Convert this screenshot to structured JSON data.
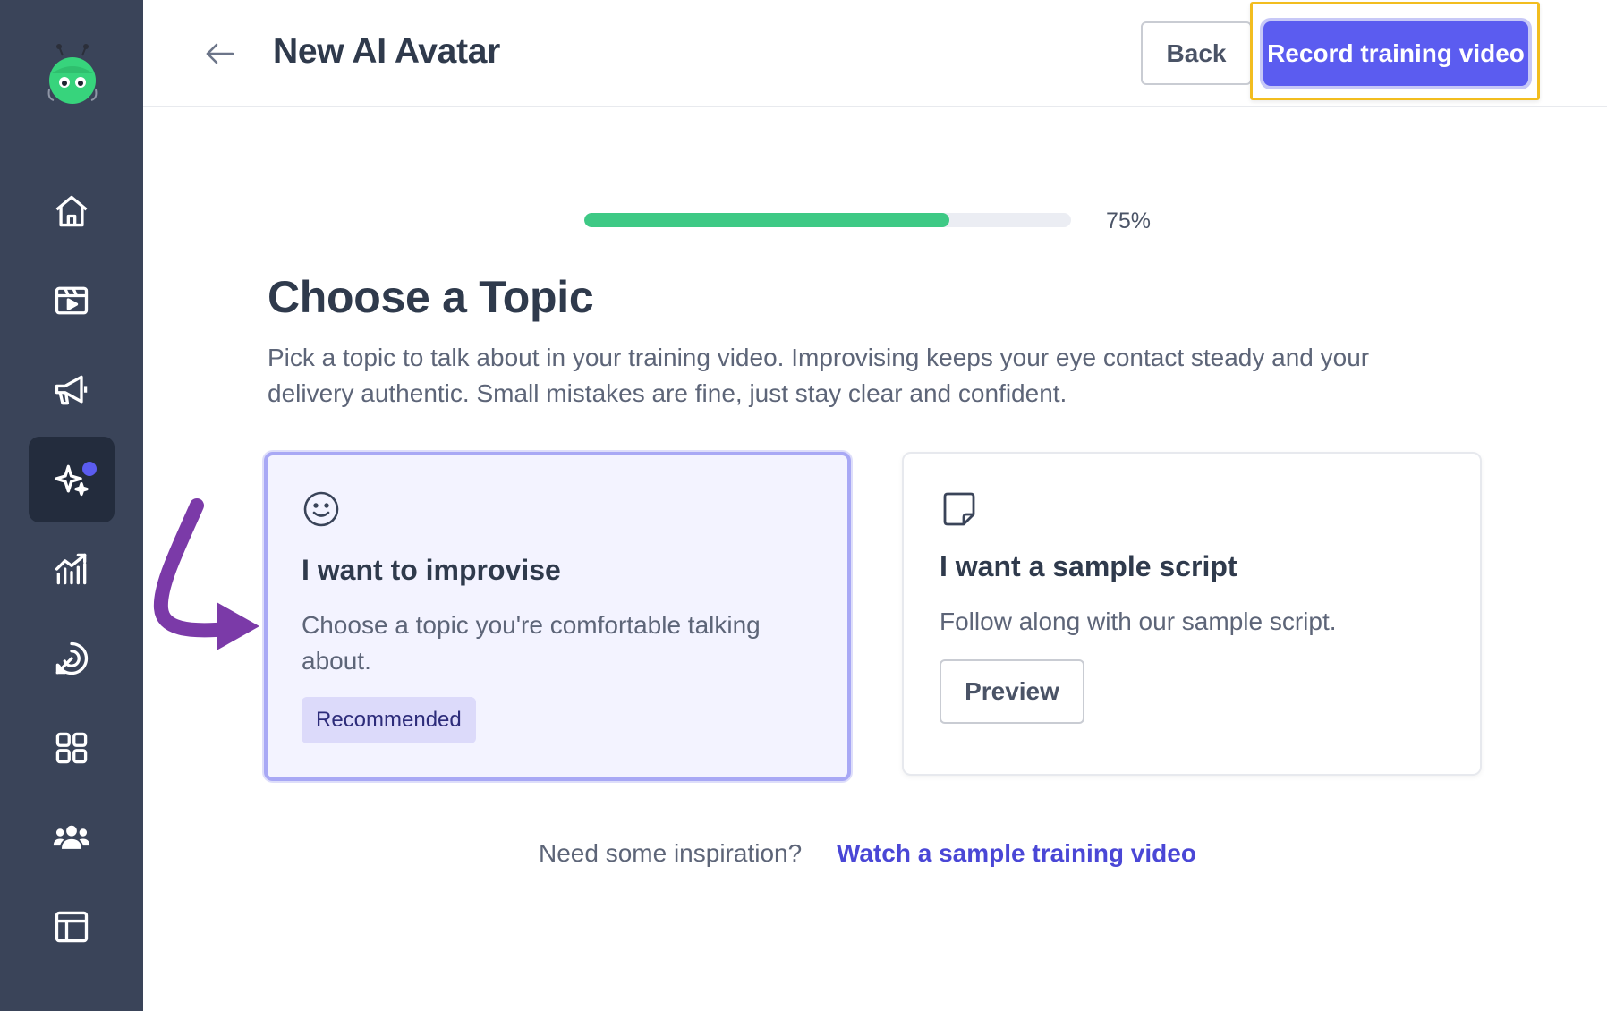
{
  "header": {
    "title": "New AI Avatar",
    "back_label": "Back",
    "record_label": "Record training video"
  },
  "sidebar": {
    "items": [
      {
        "name": "home",
        "icon": "home-icon"
      },
      {
        "name": "videos",
        "icon": "video-icon"
      },
      {
        "name": "campaigns",
        "icon": "megaphone-icon"
      },
      {
        "name": "ai-avatar",
        "icon": "sparkles-icon",
        "active": true,
        "has_notification": true
      },
      {
        "name": "analytics",
        "icon": "chart-icon"
      },
      {
        "name": "engagement",
        "icon": "target-icon"
      },
      {
        "name": "apps",
        "icon": "grid-icon"
      },
      {
        "name": "team",
        "icon": "users-icon"
      },
      {
        "name": "layouts",
        "icon": "layout-icon"
      }
    ]
  },
  "progress": {
    "value": 0.75,
    "label": "75%"
  },
  "main": {
    "title": "Choose a Topic",
    "description": "Pick a topic to talk about in your training video. Improvising keeps your eye contact steady and your delivery authentic. Small mistakes are fine, just stay clear and confident."
  },
  "cards": [
    {
      "icon": "smile-icon",
      "title": "I want to improvise",
      "description": "Choose a topic you're comfortable talking about.",
      "badge": "Recommended",
      "selected": true
    },
    {
      "icon": "note-icon",
      "title": "I want a sample script",
      "description": "Follow along with our sample script.",
      "button_label": "Preview",
      "selected": false
    }
  ],
  "footer": {
    "prompt": "Need some inspiration?",
    "link_label": "Watch a sample training video"
  },
  "colors": {
    "sidebar_bg": "#3a4459",
    "accent": "#5b5cf0",
    "progress": "#3ec985",
    "highlight": "#f2bd1f",
    "annotation": "#7b3aa8"
  }
}
